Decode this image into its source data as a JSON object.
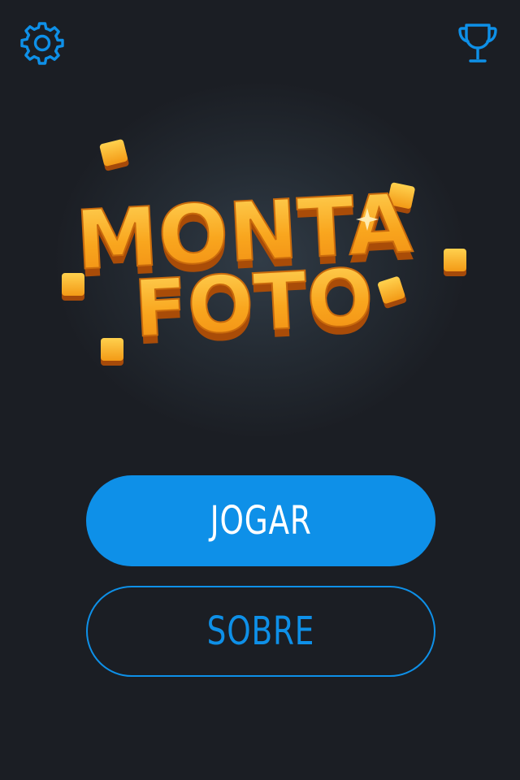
{
  "colors": {
    "background": "#1b1e24",
    "accent": "#0e90e8",
    "logo_gold": "#f7a51c",
    "logo_shadow": "#b5540a"
  },
  "header": {
    "settings_icon": "gear-icon",
    "trophy_icon": "trophy-icon"
  },
  "logo": {
    "line1": "MONTA",
    "line2": "FOTO"
  },
  "menu": {
    "play_label": "JOGAR",
    "about_label": "SOBRE"
  }
}
